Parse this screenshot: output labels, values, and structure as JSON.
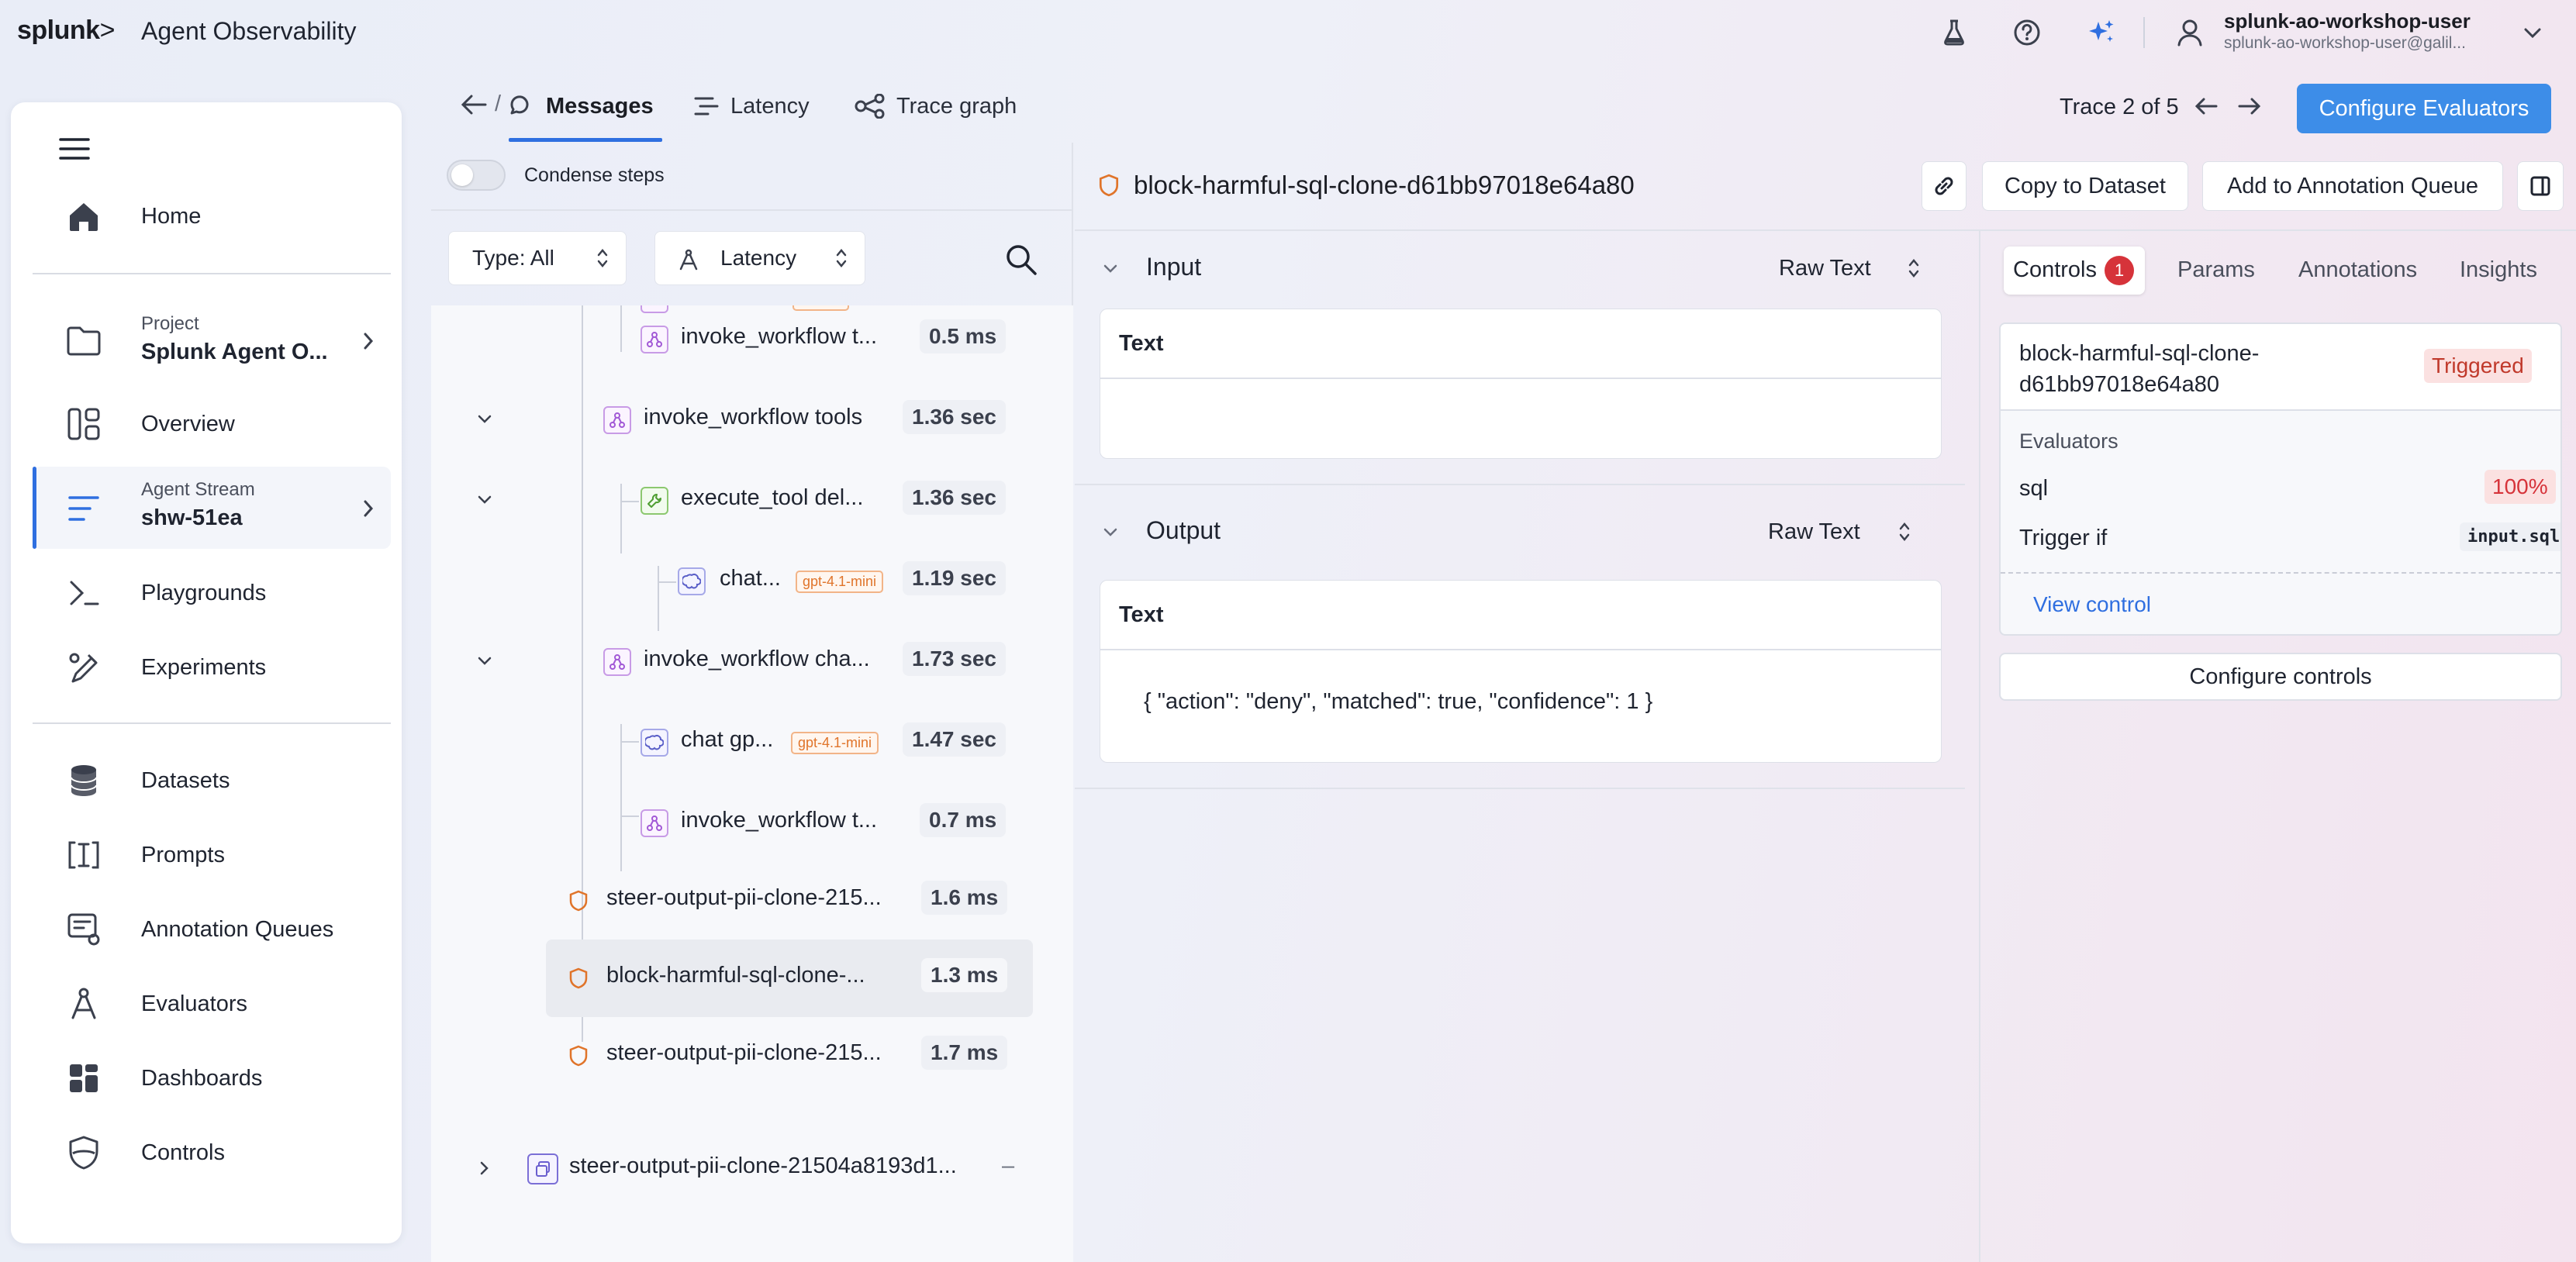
{
  "app": {
    "brand": "splunk",
    "brand_suffix": ">",
    "title": "Agent Observability"
  },
  "user": {
    "name": "splunk-ao-workshop-user",
    "email": "splunk-ao-workshop-user@galil..."
  },
  "sidebar": {
    "items": [
      {
        "label": "Home"
      },
      {
        "label_small": "Project",
        "label": "Splunk Agent O..."
      },
      {
        "label": "Overview"
      },
      {
        "label_small": "Agent Stream",
        "label": "shw-51ea"
      },
      {
        "label": "Playgrounds"
      },
      {
        "label": "Experiments"
      },
      {
        "label": "Datasets"
      },
      {
        "label": "Prompts"
      },
      {
        "label": "Annotation Queues"
      },
      {
        "label": "Evaluators"
      },
      {
        "label": "Dashboards"
      },
      {
        "label": "Controls"
      }
    ]
  },
  "tabs": {
    "sep": "/",
    "messages": "Messages",
    "latency": "Latency",
    "trace_graph": "Trace graph"
  },
  "trace_nav": {
    "label": "Trace 2 of 5"
  },
  "configure_evaluators": "Configure Evaluators",
  "condense_steps": "Condense steps",
  "filters": {
    "type": "Type: All",
    "sort": "Latency"
  },
  "tree": {
    "nodes": [
      {
        "label": "invoke_workflow t...",
        "duration": "0.5 ms"
      },
      {
        "label": "invoke_workflow tools",
        "duration": "1.36 sec"
      },
      {
        "label": "execute_tool del...",
        "duration": "1.36 sec"
      },
      {
        "label": "chat...",
        "tag": "gpt-4.1-mini",
        "duration": "1.19 sec"
      },
      {
        "label": "invoke_workflow cha...",
        "duration": "1.73 sec"
      },
      {
        "label": "chat gp...",
        "tag": "gpt-4.1-mini",
        "duration": "1.47 sec"
      },
      {
        "label": "invoke_workflow t...",
        "duration": "0.7 ms"
      },
      {
        "label": "steer-output-pii-clone-215...",
        "duration": "1.6 ms"
      },
      {
        "label": "block-harmful-sql-clone-...",
        "duration": "1.3 ms"
      },
      {
        "label": "steer-output-pii-clone-215...",
        "duration": "1.7 ms"
      },
      {
        "label": "steer-output-pii-clone-21504a8193d1...",
        "duration": "–"
      }
    ]
  },
  "detail": {
    "title": "block-harmful-sql-clone-d61bb97018e64a80",
    "copy_to_dataset": "Copy to Dataset",
    "add_to_queue": "Add to Annotation Queue",
    "input": {
      "title": "Input",
      "format": "Raw Text",
      "card_title": "Text",
      "value": ""
    },
    "output": {
      "title": "Output",
      "format": "Raw Text",
      "card_title": "Text",
      "value": "{ \"action\": \"deny\", \"matched\": true, \"confidence\": 1 }"
    }
  },
  "right": {
    "tabs": {
      "controls": "Controls",
      "controls_count": "1",
      "params": "Params",
      "annotations": "Annotations",
      "insights": "Insights"
    },
    "control": {
      "name": "block-harmful-sql-clone-d61bb97018e64a80",
      "status": "Triggered",
      "evaluators_label": "Evaluators",
      "evaluator_name": "sql",
      "evaluator_score": "100%",
      "trigger_label": "Trigger if",
      "trigger_value": "input.sql",
      "view_link": "View control"
    },
    "configure_controls": "Configure controls"
  },
  "colors": {
    "accent": "#3d8de8",
    "link": "#2f6fe0",
    "danger": "#d6333a",
    "warning": "#e0742a"
  },
  "icons": {
    "top": [
      "flask-icon",
      "help-circle-icon",
      "sparkles-icon",
      "user-icon",
      "chevron-down-icon"
    ],
    "sidebar": [
      "menu-icon",
      "home-icon",
      "folder-icon",
      "overview-icon",
      "stream-icon",
      "terminal-icon",
      "flask-pen-icon",
      "database-icon",
      "prompt-icon",
      "annotation-icon",
      "evaluator-icon",
      "dashboard-icon",
      "shield-icon"
    ]
  }
}
